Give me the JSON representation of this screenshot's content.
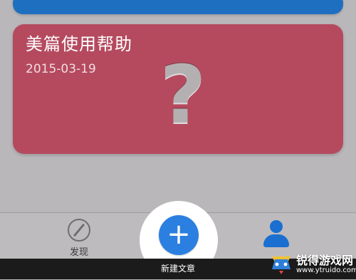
{
  "cards": {
    "help": {
      "title": "美篇使用帮助",
      "date": "2015-03-19",
      "icon": "question-mark-icon",
      "question_glyph": "?",
      "color": "#b54a5f"
    },
    "top_card_color": "#1f6fc1"
  },
  "tabbar": {
    "discover_label": "发现",
    "discover_icon": "compass-icon",
    "add_icon": "plus-icon",
    "add_glyph": "+",
    "profile_icon": "person-icon",
    "accent": "#2b7fe0"
  },
  "caption": {
    "text": "新建文章"
  },
  "watermark": {
    "title": "锐得游戏网",
    "url": "www.ytruido.com",
    "logo_icon": "game-controller-logo"
  }
}
